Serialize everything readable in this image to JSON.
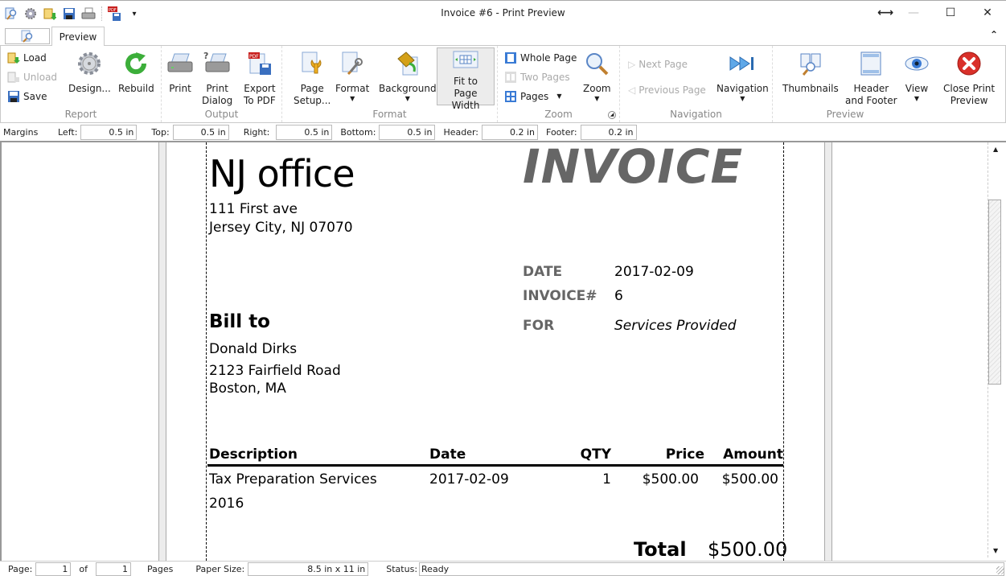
{
  "window": {
    "title": "Invoice #6 - Print Preview",
    "controls": {
      "resize_glyph": "⟷",
      "minimize_glyph": "—",
      "maximize_glyph": "☐",
      "close_glyph": "✕"
    }
  },
  "quick_access": [
    {
      "name": "preview-icon"
    },
    {
      "name": "settings-icon"
    },
    {
      "name": "load-icon"
    },
    {
      "name": "save-icon"
    },
    {
      "name": "print-icon"
    },
    {
      "name": "export-pdf-icon"
    },
    {
      "name": "customize-icon",
      "glyph": "▾"
    }
  ],
  "tabs": {
    "active": "Preview"
  },
  "ribbon": {
    "groups": {
      "report": {
        "label": "Report",
        "load": "Load",
        "unload": "Unload",
        "save": "Save",
        "design": "Design...",
        "rebuild": "Rebuild"
      },
      "output": {
        "label": "Output",
        "print": "Print",
        "print_dialog_1": "Print",
        "print_dialog_2": "Dialog",
        "export_1": "Export",
        "export_2": "To PDF"
      },
      "format": {
        "label": "Format",
        "page_setup_1": "Page",
        "page_setup_2": "Setup...",
        "format": "Format",
        "background": "Background",
        "fit_1": "Fit to Page",
        "fit_2": "Width"
      },
      "zoom": {
        "label": "Zoom",
        "whole_page": "Whole Page",
        "two_pages": "Two Pages",
        "pages": "Pages",
        "zoom": "Zoom"
      },
      "navigation": {
        "label": "Navigation",
        "next_page": "Next Page",
        "previous_page": "Previous Page",
        "navigation": "Navigation"
      },
      "preview": {
        "label": "Preview",
        "thumbnails": "Thumbnails",
        "header_footer_1": "Header",
        "header_footer_2": "and Footer",
        "view": "View",
        "close_1": "Close Print",
        "close_2": "Preview"
      }
    }
  },
  "margins": {
    "label": "Margins",
    "left_label": "Left:",
    "left": "0.5 in",
    "top_label": "Top:",
    "top": "0.5 in",
    "right_label": "Right:",
    "right": "0.5 in",
    "bottom_label": "Bottom:",
    "bottom": "0.5 in",
    "header_label": "Header:",
    "header": "0.2 in",
    "footer_label": "Footer:",
    "footer": "0.2 in"
  },
  "invoice": {
    "company": "NJ office",
    "address_1": "111 First ave",
    "address_2": "Jersey City, NJ 07070",
    "title": "INVOICE",
    "date_label": "DATE",
    "date": "2017-02-09",
    "number_label": "INVOICE#",
    "number": "6",
    "for_label": "FOR",
    "for": "Services Provided",
    "bill_to_label": "Bill to",
    "bill_name": "Donald Dirks",
    "bill_addr_1": "2123 Fairfield Road",
    "bill_addr_2": "Boston, MA",
    "columns": [
      "Description",
      "Date",
      "QTY",
      "Price",
      "Amount"
    ],
    "items": [
      {
        "description": "Tax Preparation Services",
        "description_2": "2016",
        "date": "2017-02-09",
        "qty": "1",
        "price": "$500.00",
        "amount": "$500.00"
      }
    ],
    "total_label": "Total",
    "total": "$500.00"
  },
  "statusbar": {
    "page_label": "Page:",
    "page": "1",
    "of_label": "of",
    "pages": "1",
    "pages_label": "Pages",
    "paper_size_label": "Paper Size:",
    "paper_size": "8.5 in x 11 in",
    "status_label": "Status:",
    "status": "Ready"
  },
  "colors": {
    "accent_blue": "#3a7bd5",
    "invoice_gray": "#666666",
    "close_red": "#d9302a",
    "rebuild_green": "#3cae3a"
  }
}
